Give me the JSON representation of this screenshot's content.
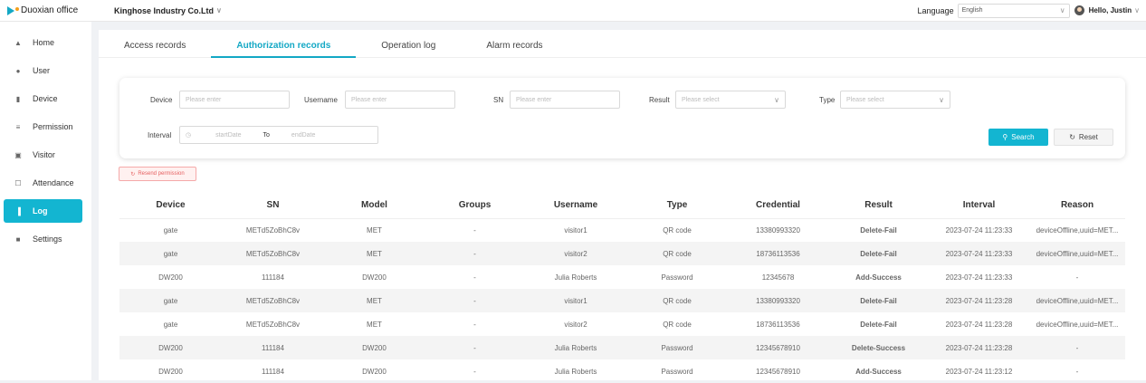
{
  "app": {
    "logo_text": "Duoxian office",
    "company": "Kinghose Industry Co.Ltd"
  },
  "header": {
    "language_label": "Language",
    "language_value": "English",
    "greeting": "Hello,  Justin"
  },
  "sidebar": {
    "items": [
      {
        "label": "Home",
        "icon": "home-icon"
      },
      {
        "label": "User",
        "icon": "user-icon"
      },
      {
        "label": "Device",
        "icon": "device-icon"
      },
      {
        "label": "Permission",
        "icon": "permission-icon"
      },
      {
        "label": "Visitor",
        "icon": "visitor-icon"
      },
      {
        "label": "Attendance",
        "icon": "attendance-icon"
      },
      {
        "label": "Log",
        "icon": "log-icon",
        "active": true
      },
      {
        "label": "Settings",
        "icon": "settings-icon"
      }
    ]
  },
  "tabs": [
    "Access records",
    "Authorization records",
    "Operation log",
    "Alarm records"
  ],
  "active_tab": "Authorization records",
  "filter": {
    "device_label": "Device",
    "device_placeholder": "Please enter",
    "username_label": "Username",
    "username_placeholder": "Please enter",
    "sn_label": "SN",
    "sn_placeholder": "Please enter",
    "result_label": "Result",
    "result_placeholder": "Please select",
    "type_label": "Type",
    "type_placeholder": "Please select",
    "interval_label": "Interval",
    "start_placeholder": "startDate",
    "to_label": "To",
    "end_placeholder": "endDate",
    "search_label": "Search",
    "reset_label": "Reset"
  },
  "resend_label": "Resend permission",
  "table": {
    "columns": [
      "Device",
      "SN",
      "Model",
      "Groups",
      "Username",
      "Type",
      "Credential",
      "Result",
      "Interval",
      "Reason"
    ],
    "rows": [
      [
        "gate",
        "METd5ZoBhC8v",
        "MET",
        "-",
        "visitor1",
        "QR code",
        "13380993320",
        "Delete-Fail",
        "2023-07-24 11:23:33",
        "deviceOffline,uuid=MET..."
      ],
      [
        "gate",
        "METd5ZoBhC8v",
        "MET",
        "-",
        "visitor2",
        "QR code",
        "18736113536",
        "Delete-Fail",
        "2023-07-24 11:23:33",
        "deviceOffline,uuid=MET..."
      ],
      [
        "DW200",
        "111184",
        "DW200",
        "-",
        "Julia Roberts",
        "Password",
        "12345678",
        "Add-Success",
        "2023-07-24 11:23:33",
        "-"
      ],
      [
        "gate",
        "METd5ZoBhC8v",
        "MET",
        "-",
        "visitor1",
        "QR code",
        "13380993320",
        "Delete-Fail",
        "2023-07-24 11:23:28",
        "deviceOffline,uuid=MET..."
      ],
      [
        "gate",
        "METd5ZoBhC8v",
        "MET",
        "-",
        "visitor2",
        "QR code",
        "18736113536",
        "Delete-Fail",
        "2023-07-24 11:23:28",
        "deviceOffline,uuid=MET..."
      ],
      [
        "DW200",
        "111184",
        "DW200",
        "-",
        "Julia Roberts",
        "Password",
        "12345678910",
        "Delete-Success",
        "2023-07-24 11:23:28",
        "-"
      ],
      [
        "DW200",
        "111184",
        "DW200",
        "-",
        "Julia Roberts",
        "Password",
        "12345678910",
        "Add-Success",
        "2023-07-24 11:23:12",
        "-"
      ]
    ]
  },
  "colors": {
    "accent": "#13b5d1",
    "fail": "#f56022",
    "success": "#19a96b"
  }
}
